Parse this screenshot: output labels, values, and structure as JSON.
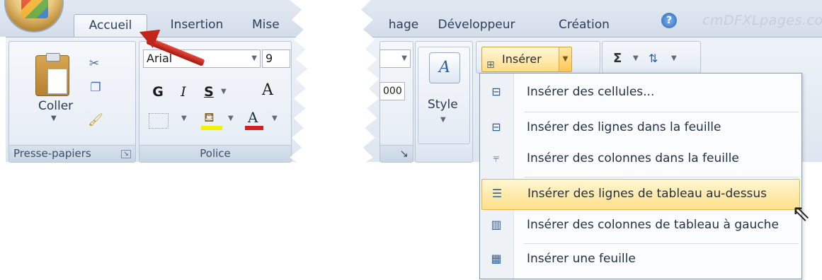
{
  "tabs": [
    "Accueil",
    "Insertion",
    "Mise",
    "hage",
    "Développeur",
    "Création"
  ],
  "watermark": "cmDFXLpages.com",
  "clipboard": {
    "paste_label": "Coller",
    "group_label": "Presse-papiers"
  },
  "font": {
    "family": "Arial",
    "size": "9",
    "bold": "G",
    "italic": "I",
    "underline": "S",
    "grow": "A",
    "color_letter": "A",
    "group_label": "Police"
  },
  "number": {
    "zoom": "000"
  },
  "style": {
    "label": "Style"
  },
  "insert": {
    "button_label": "Insérer",
    "sum_glyph": "Σ",
    "menu": [
      {
        "label": "Insérer des cellules...",
        "icon": "insert-cells-icon"
      },
      {
        "label": "Insérer des lignes dans la feuille",
        "icon": "insert-rows-icon"
      },
      {
        "label": "Insérer des colonnes dans la feuille",
        "icon": "insert-columns-icon"
      },
      {
        "label": "Insérer des lignes de tableau au-dessus",
        "icon": "insert-table-rows-icon",
        "highlighted": true
      },
      {
        "label": "Insérer des colonnes de tableau à gauche",
        "icon": "insert-table-columns-icon"
      },
      {
        "label": "Insérer une feuille",
        "icon": "insert-sheet-icon"
      }
    ]
  },
  "colors": {
    "highlight": "#ffe08a",
    "arrow": "#c0261a",
    "ribbon": "#dde6f0"
  }
}
